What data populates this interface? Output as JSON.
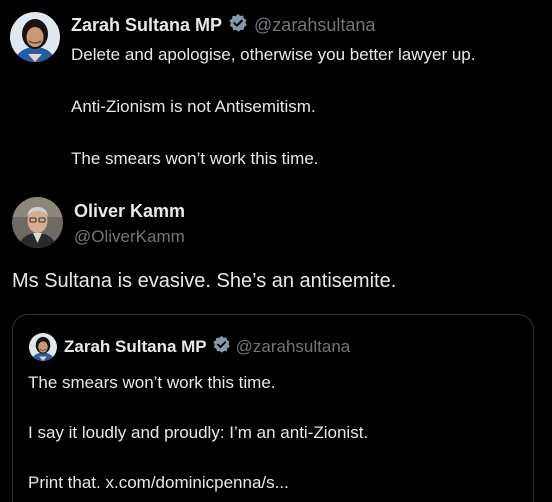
{
  "tweet": {
    "author_name": "Zarah Sultana MP",
    "author_handle": "@zarahsultana",
    "author_verified": true,
    "lines": [
      "Delete and apologise, otherwise you better lawyer up.",
      "Anti-Zionism is not Antisemitism.",
      "The smears won’t work this time."
    ]
  },
  "reply": {
    "author_name": "Oliver Kamm",
    "author_handle": "@OliverKamm",
    "text": "Ms Sultana is evasive. She’s an antisemite."
  },
  "quoted_tweet": {
    "author_name": "Zarah Sultana MP",
    "author_handle": "@zarahsultana",
    "author_verified": true,
    "lines": [
      "The smears won’t work this time.",
      "I say it loudly and proudly: I’m an anti-Zionist.",
      "Print that. x.com/dominicpenna/s..."
    ]
  },
  "icons": {
    "verified": "verified-badge-icon"
  },
  "colors": {
    "background": "#000000",
    "text": "#e7e9ea",
    "handle": "#71767b",
    "verified_badge": "#829aab",
    "card_border": "#2f3336"
  }
}
